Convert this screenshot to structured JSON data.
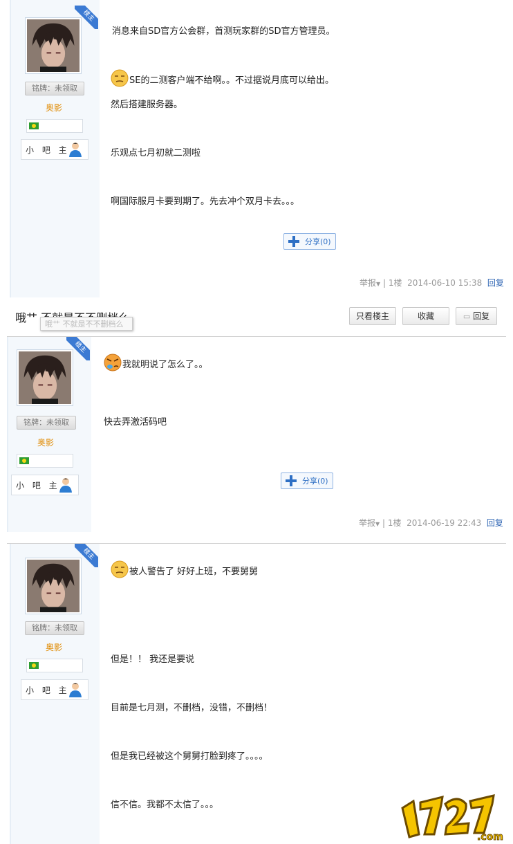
{
  "thread": {
    "title": "哦艹 不就是不不删档么",
    "tooltip": "哦艹 不就是不不删档么",
    "buttons": {
      "lz_only": "只看楼主",
      "favorite": "收藏",
      "reply": "回复"
    }
  },
  "author": {
    "medal": "铭牌：未领取",
    "name": "奥影",
    "role": "小 吧 主",
    "ribbon": "楼主"
  },
  "posts": [
    {
      "lines": [
        "消息来自SD官方公会群，首测玩家群的SD官方管理员。",
        "SE的二测客户端不给啊。。不过据说月底可以给出。",
        "然后搭建服务器。",
        "乐观点七月初就二测啦",
        "啊国际服月卡要到期了。先去冲个双月卡去。。。"
      ],
      "share": "分享(0)",
      "report": "举报",
      "floor": "1楼",
      "time": "2014-06-10 15:38",
      "reply": "回复"
    },
    {
      "lines": [
        "我就明说了怎么了。。",
        "快去弄激活码吧"
      ],
      "share": "分享(0)",
      "report": "举报",
      "floor": "1楼",
      "time": "2014-06-19 22:43",
      "reply": "回复"
    },
    {
      "lines": [
        "被人警告了 好好上班，不要舅舅",
        "但是！！ 我还是要说",
        "目前是七月测，不删档，没错，不删档！",
        "但是我已经被这个舅舅打脸到疼了。。。。",
        "信不信。我都不太信了。。。"
      ]
    }
  ],
  "colors": {
    "accent": "#2e6fc4",
    "username": "#e08a00",
    "sidebar": "#f4f8fc"
  },
  "watermark": "1727.com"
}
